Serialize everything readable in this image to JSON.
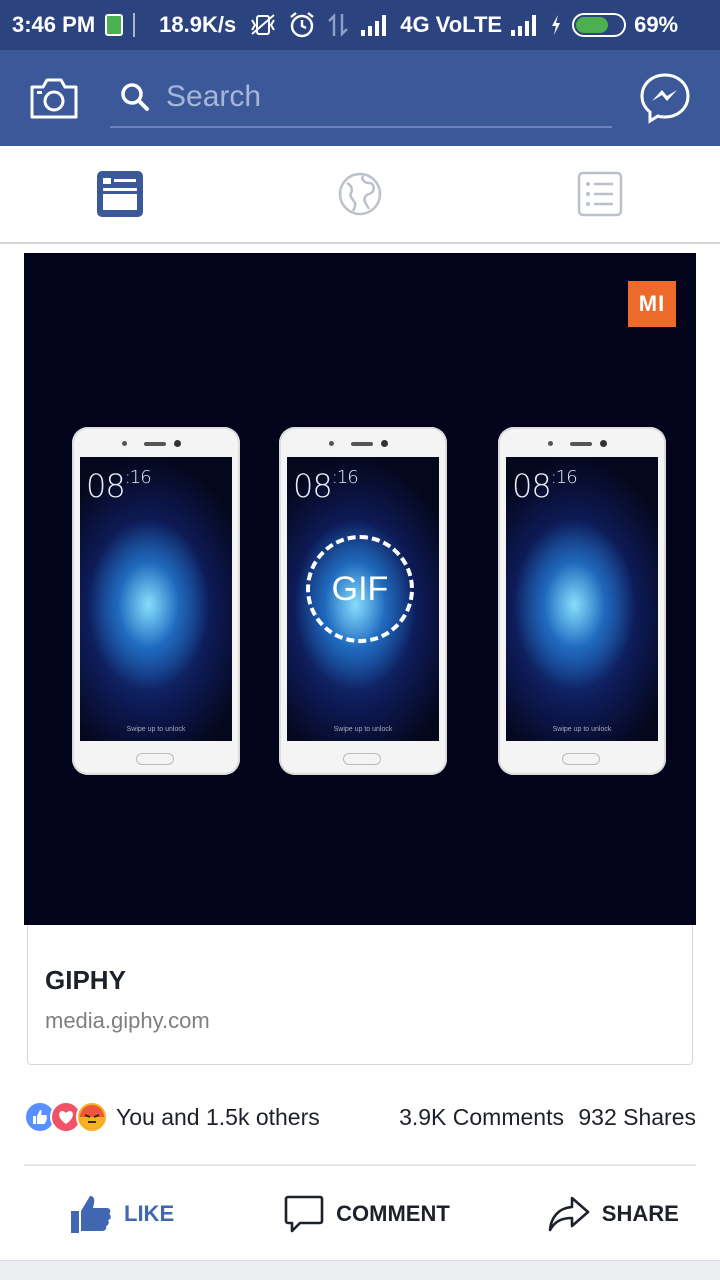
{
  "status_bar": {
    "time": "3:46 PM",
    "speed": "18.9K/s",
    "network": "4G VoLTE",
    "battery": "69%",
    "battery_level": 0.69
  },
  "header": {
    "search_placeholder": "Search"
  },
  "post": {
    "brand_logo_text": "MI",
    "gif_label": "GIF",
    "phone_clock_hour": "08",
    "phone_clock_min": ":16",
    "phone_swipe_text": "Swipe up to unlock",
    "link_title": "GIPHY",
    "link_domain": "media.giphy.com",
    "reactions_text": "You and 1.5k others",
    "comments": "3.9K Comments",
    "shares": "932 Shares"
  },
  "actions": {
    "like": "LIKE",
    "comment": "COMMENT",
    "share": "SHARE"
  },
  "colors": {
    "header_bg": "#3b5998",
    "status_bg": "#2b4480",
    "like_blue": "#4267b2"
  }
}
